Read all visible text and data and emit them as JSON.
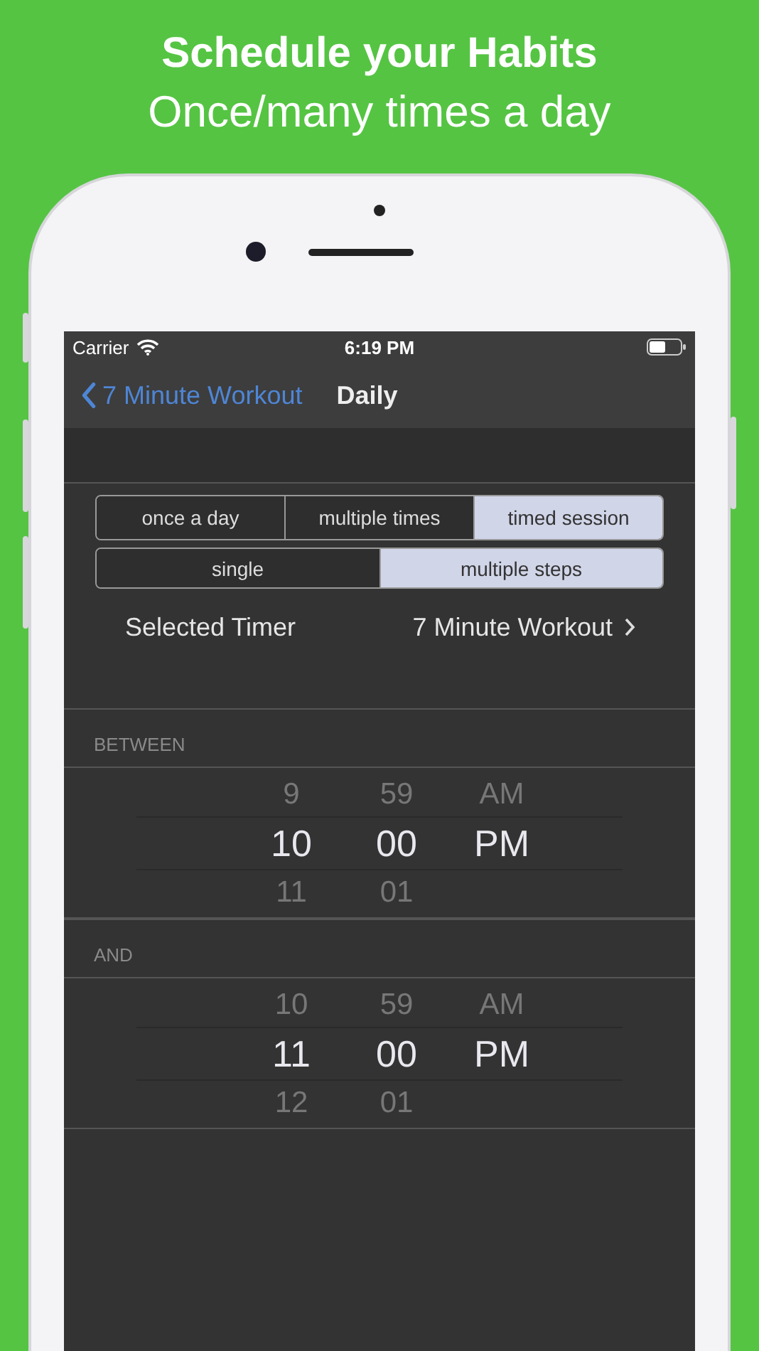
{
  "headline": {
    "title": "Schedule your Habits",
    "subtitle": "Once/many times a day"
  },
  "status_bar": {
    "carrier": "Carrier",
    "time": "6:19 PM"
  },
  "nav": {
    "back": "7 Minute Workout",
    "title": "Daily"
  },
  "frequency_segments": [
    {
      "label": "once a day",
      "selected": false
    },
    {
      "label": "multiple times",
      "selected": false
    },
    {
      "label": "timed session",
      "selected": true
    }
  ],
  "step_segments": [
    {
      "label": "single",
      "selected": false
    },
    {
      "label": "multiple steps",
      "selected": true
    }
  ],
  "timer_row": {
    "label": "Selected Timer",
    "value": "7 Minute Workout"
  },
  "pickers": [
    {
      "label": "BETWEEN",
      "columns": [
        {
          "items": [
            {
              "text": "9",
              "selected": false
            },
            {
              "text": "10",
              "selected": true
            },
            {
              "text": "11",
              "selected": false
            }
          ]
        },
        {
          "items": [
            {
              "text": "59",
              "selected": false
            },
            {
              "text": "00",
              "selected": true
            },
            {
              "text": "01",
              "selected": false
            }
          ]
        },
        {
          "items": [
            {
              "text": "AM",
              "selected": false
            },
            {
              "text": "PM",
              "selected": true
            }
          ]
        }
      ]
    },
    {
      "label": "AND",
      "columns": [
        {
          "items": [
            {
              "text": "10",
              "selected": false
            },
            {
              "text": "11",
              "selected": true
            },
            {
              "text": "12",
              "selected": false
            }
          ]
        },
        {
          "items": [
            {
              "text": "59",
              "selected": false
            },
            {
              "text": "00",
              "selected": true
            },
            {
              "text": "01",
              "selected": false
            }
          ]
        },
        {
          "items": [
            {
              "text": "AM",
              "selected": false
            },
            {
              "text": "PM",
              "selected": true
            }
          ]
        }
      ]
    }
  ]
}
